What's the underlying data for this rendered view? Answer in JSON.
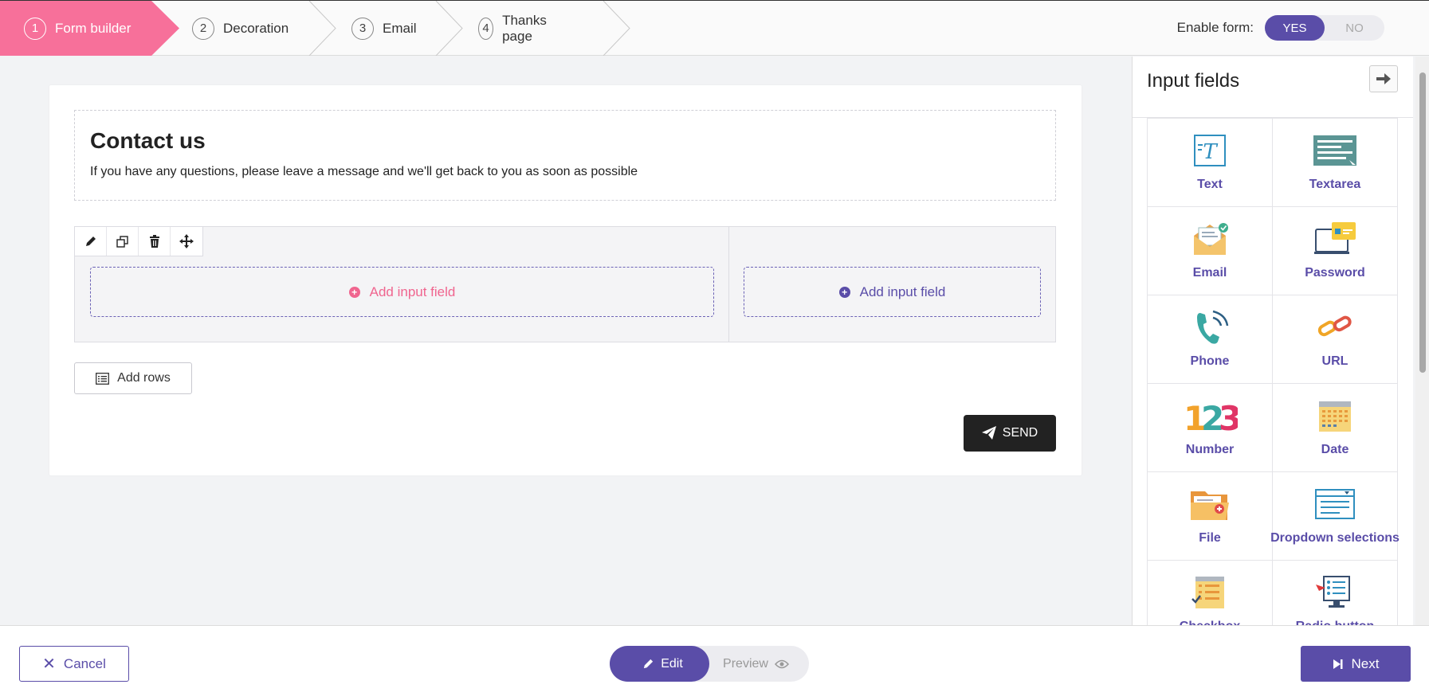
{
  "wizard": {
    "steps": [
      {
        "num": "1",
        "label": "Form builder"
      },
      {
        "num": "2",
        "label": "Decoration"
      },
      {
        "num": "3",
        "label": "Email"
      },
      {
        "num": "4",
        "label": "Thanks page"
      }
    ],
    "active_step": 1
  },
  "enable_form": {
    "label": "Enable form:",
    "yes": "YES",
    "no": "NO",
    "selected": "YES"
  },
  "form": {
    "title": "Contact us",
    "description": "If you have any questions, please leave a message and we'll get back to you as soon as possible",
    "add_field_label": "Add input field",
    "add_rows_label": "Add rows",
    "send_label": "SEND"
  },
  "sidebar": {
    "title": "Input fields",
    "fields": [
      {
        "label": "Text",
        "icon": "text-icon"
      },
      {
        "label": "Textarea",
        "icon": "textarea-icon"
      },
      {
        "label": "Email",
        "icon": "email-icon"
      },
      {
        "label": "Password",
        "icon": "password-icon"
      },
      {
        "label": "Phone",
        "icon": "phone-icon"
      },
      {
        "label": "URL",
        "icon": "url-icon"
      },
      {
        "label": "Number",
        "icon": "number-icon"
      },
      {
        "label": "Date",
        "icon": "date-icon"
      },
      {
        "label": "File",
        "icon": "file-icon"
      },
      {
        "label": "Dropdown selections",
        "icon": "dropdown-icon"
      },
      {
        "label": "Checkbox",
        "icon": "checkbox-icon"
      },
      {
        "label": "Radio button",
        "icon": "radio-icon"
      }
    ]
  },
  "bottom": {
    "cancel": "Cancel",
    "edit": "Edit",
    "preview": "Preview",
    "next": "Next"
  },
  "colors": {
    "accent": "#5a4da8",
    "pink": "#f7709a",
    "dark": "#222222"
  }
}
